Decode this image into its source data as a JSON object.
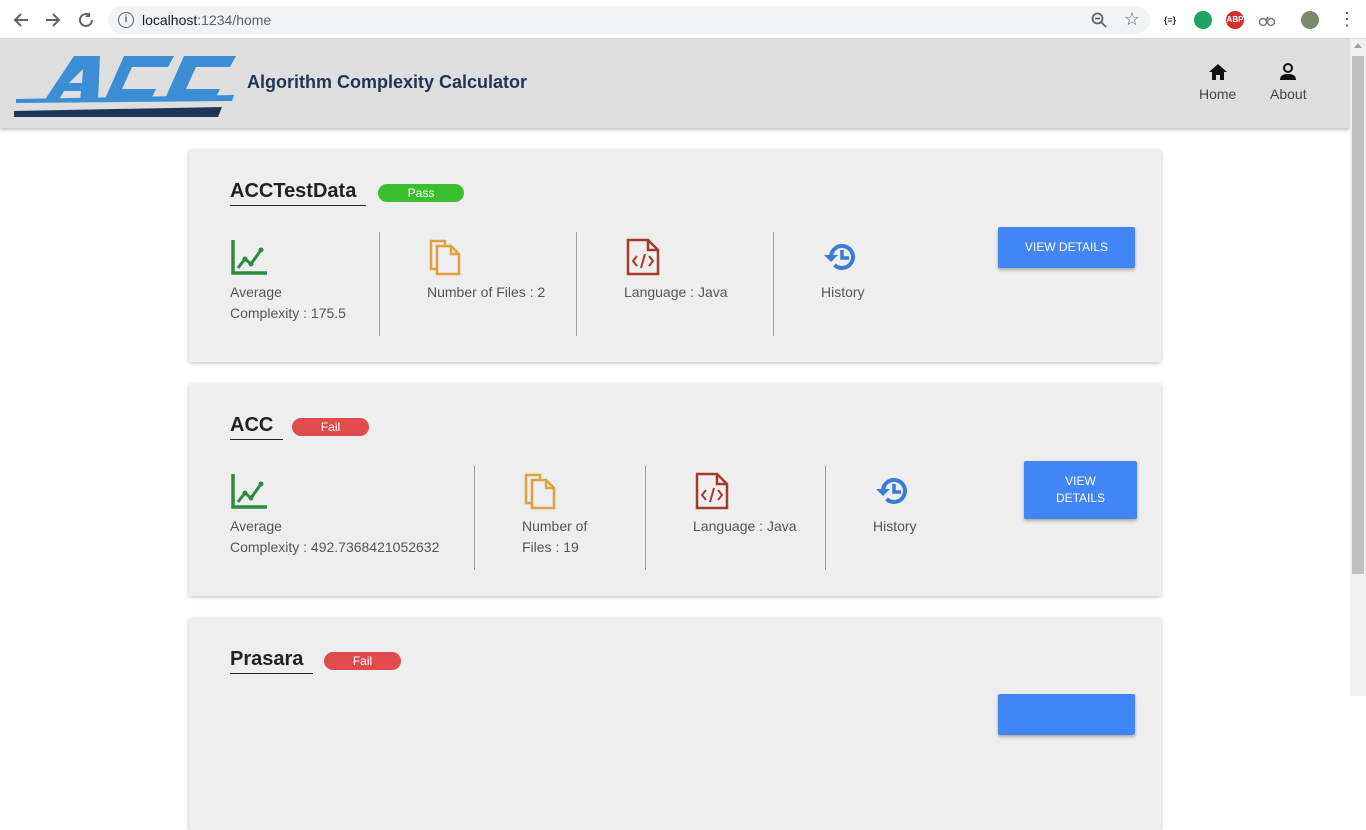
{
  "browser": {
    "url_host": "localhost",
    "url_path": ":1234/home",
    "ext_label_1": "{≡}",
    "ext_label_2": "ABP"
  },
  "app": {
    "logo_text": "ACC",
    "title": "Algorithm Complexity Calculator",
    "nav": [
      {
        "label": "Home",
        "icon": "home-icon"
      },
      {
        "label": "About",
        "icon": "user-icon"
      }
    ]
  },
  "colors": {
    "accent": "#4285f4",
    "pass": "#3cbf2f",
    "fail": "#e24b4b",
    "chart_icon": "#2e8b3e",
    "file_icon": "#e0a040",
    "code_icon": "#a33a2a",
    "history_icon": "#3a7bd5"
  },
  "cards": [
    {
      "title": "ACCTestData",
      "status": "Pass",
      "complexity_line1": "Average",
      "complexity_line2": "Complexity : 175.5",
      "files_line1": "Number of Files : 2",
      "files_line2": "",
      "language": "Language : Java",
      "history": "History",
      "button_line1": "VIEW DETAILS",
      "button_line2": ""
    },
    {
      "title": "ACC",
      "status": "Fail",
      "complexity_line1": "Average",
      "complexity_line2": "Complexity : 492.7368421052632",
      "files_line1": "Number of",
      "files_line2": "Files : 19",
      "language": "Language : Java",
      "history": "History",
      "button_line1": "VIEW",
      "button_line2": "DETAILS"
    },
    {
      "title": "Prasara",
      "status": "Fail"
    }
  ]
}
